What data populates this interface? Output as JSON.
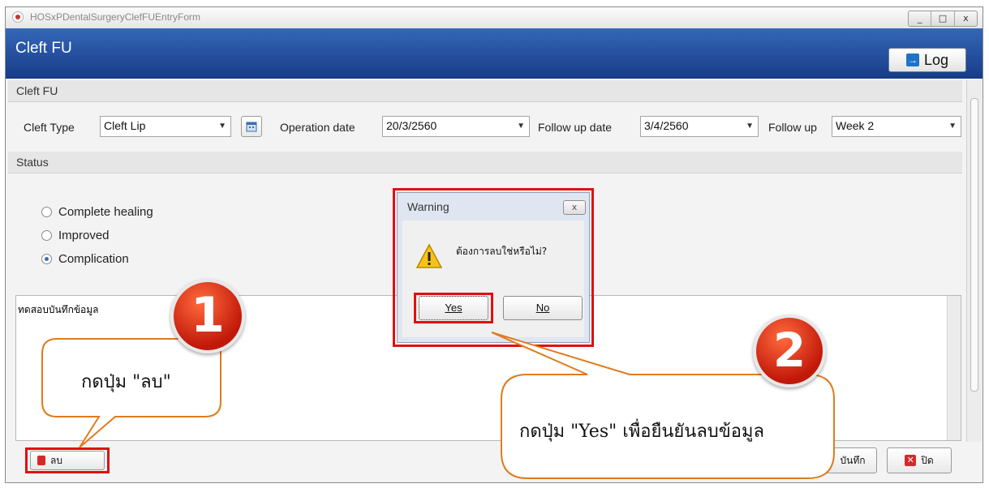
{
  "window": {
    "title": "HOSxPDentalSurgeryClefFUEntryForm",
    "controls": [
      "_",
      "□",
      "x"
    ]
  },
  "header": {
    "title": "Cleft FU",
    "log_label": "Log"
  },
  "cleft_group": {
    "title": "Cleft FU",
    "cleft_type_label": "Cleft Type",
    "cleft_type_value": "Cleft Lip",
    "operation_date_label": "Operation date",
    "operation_date_value": "20/3/2560",
    "follow_up_date_label": "Follow up date",
    "follow_up_date_value": "3/4/2560",
    "follow_up_label": "Follow up",
    "follow_up_value": "Week 2"
  },
  "status_group": {
    "title": "Status",
    "options": [
      {
        "label": "Complete healing",
        "selected": false
      },
      {
        "label": "Improved",
        "selected": false
      },
      {
        "label": "Complication",
        "selected": true
      }
    ]
  },
  "note": {
    "text": "ทดสอบบันทึกข้อมูล"
  },
  "footer": {
    "delete_label": "ลบ",
    "save_label": "บันทึก",
    "close_label": "ปิด"
  },
  "dialog": {
    "title": "Warning",
    "close": "x",
    "message": "ต้องการลบใช่หรือไม่?",
    "yes_label": "Yes",
    "no_label": "No"
  },
  "annotations": {
    "step1_number": "1",
    "step1_text": "กดปุ่ม \"ลบ\"",
    "step2_number": "2",
    "step2_text": "กดปุ่ม \"Yes\" เพื่อยืนยันลบข้อมูล"
  },
  "colors": {
    "header_blue": "#1f4a96",
    "highlight_red": "#e01010",
    "callout_orange": "#e07b1c"
  }
}
